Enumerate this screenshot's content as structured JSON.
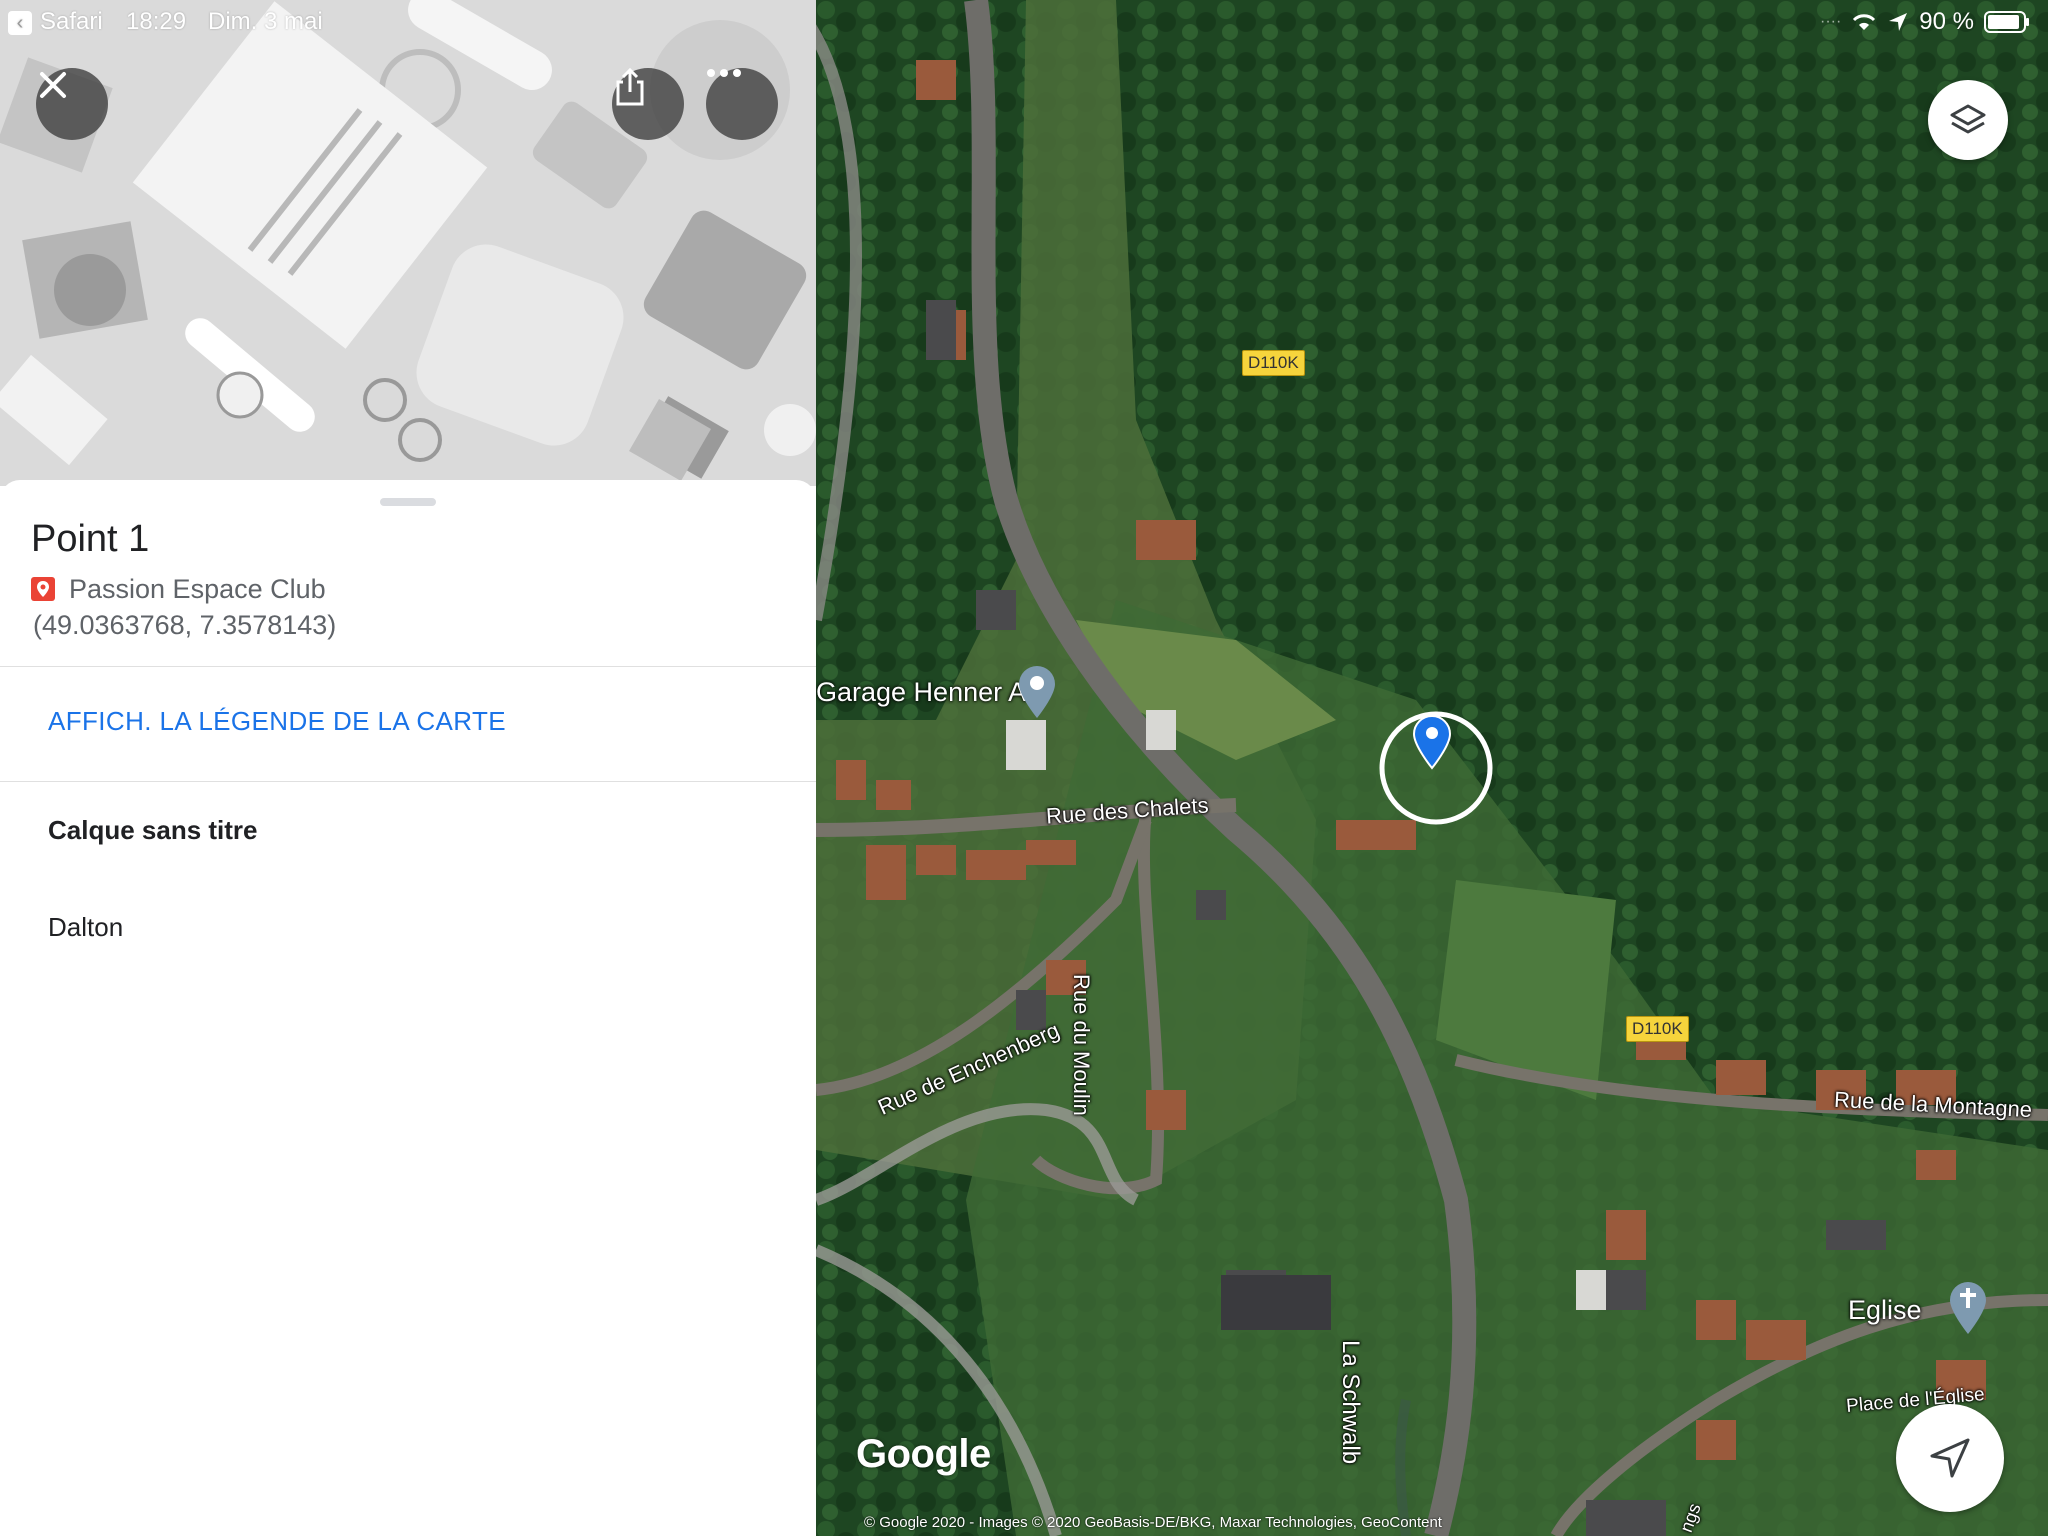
{
  "status_bar": {
    "back_app": "Safari",
    "time": "18:29",
    "date": "Dim. 3 mai",
    "battery": "90 %"
  },
  "place": {
    "title": "Point 1",
    "list_name": "Passion Espace Club",
    "coordinates": "(49.0363768, 7.3578143)"
  },
  "sheet": {
    "legend_link": "AFFICH. LA LÉGENDE DE LA CARTE",
    "layer_title": "Calque sans titre",
    "layer_items": [
      "Dalton"
    ]
  },
  "map": {
    "road_badges": [
      "D110K",
      "D110K"
    ],
    "streets": [
      "Rue des Chalets",
      "Rue du Moulin",
      "Rue de Enchenberg",
      "Rue de la Montagne",
      "La Schwalb",
      "Place de l'Église",
      "ngs"
    ],
    "pois": [
      "Garage Henner A",
      "Eglise"
    ],
    "logo": "Google",
    "copyright": "© Google 2020 - Images © 2020 GeoBasis-DE/BKG, Maxar Technologies, GeoContent"
  },
  "colors": {
    "link": "#1a73e8",
    "pin": "#1a73e8",
    "forest": "#1f4a24",
    "road": "#5a5a58",
    "road_badge": "#f6d43c"
  },
  "icons": [
    "close-icon",
    "share-icon",
    "more-icon",
    "layers-icon",
    "location-arrow-icon",
    "map-pin-icon",
    "wifi-icon",
    "battery-icon"
  ]
}
